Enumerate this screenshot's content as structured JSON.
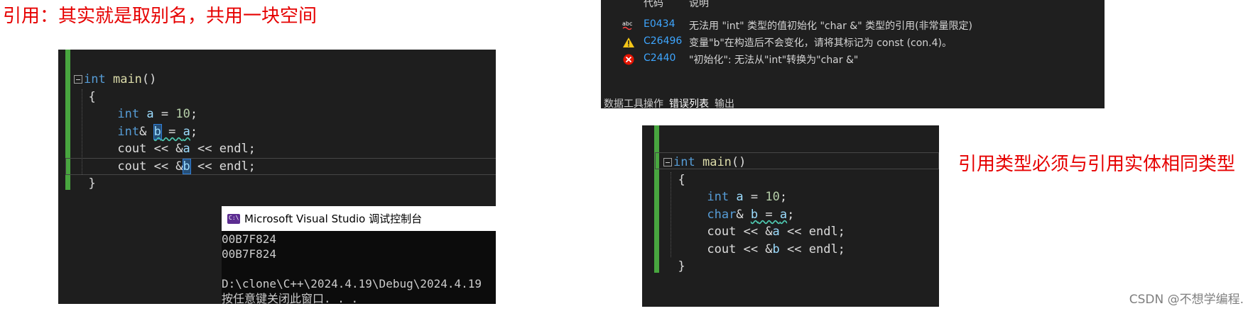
{
  "titles": {
    "left": "引用：其实就是取别名，共用一块空间",
    "right": "引用类型必须与引用实体相同类型"
  },
  "code_left": {
    "line1": {
      "kw": "int",
      "fn": "main",
      "rest": "()"
    },
    "line2": "{",
    "line3": {
      "kw": "int",
      "var": "a",
      "op": " = ",
      "num": "10",
      "end": ";"
    },
    "line4": {
      "kw": "int",
      "amp": "& ",
      "var": "b",
      "op": " = ",
      "var2": "a",
      "end": ";"
    },
    "line5": {
      "pre": "cout << &",
      "var": "a",
      "post": " << endl;"
    },
    "line6": {
      "pre": "cout << &",
      "var": "b",
      "post": " << endl;"
    },
    "line7": "}"
  },
  "console": {
    "title": "Microsoft Visual Studio 调试控制台",
    "lines": [
      "00B7F824",
      "00B7F824",
      "",
      "D:\\clone\\C++\\2024.4.19\\Debug\\2024.4.19",
      "按任意键关闭此窗口. . ."
    ]
  },
  "error_list": {
    "header_code": "代码",
    "header_desc": "说明",
    "rows": [
      {
        "icon": "abc-icon",
        "code": "E0434",
        "desc": "无法用 \"int\" 类型的值初始化 \"char &\" 类型的引用(非常量限定)"
      },
      {
        "icon": "warning-icon",
        "code": "C26496",
        "desc": "变量\"b\"在构造后不会变化，请将其标记为 const (con.4)。"
      },
      {
        "icon": "error-icon",
        "code": "C2440",
        "desc": "\"初始化\": 无法从\"int\"转换为\"char &\""
      }
    ],
    "tabs": [
      "数据工具操作",
      "错误列表",
      "输出"
    ]
  },
  "code_right": {
    "line1": {
      "kw": "int",
      "fn": "main",
      "rest": "()"
    },
    "line2": "{",
    "line3": {
      "kw": "int",
      "var": "a",
      "op": " = ",
      "num": "10",
      "end": ";"
    },
    "line4": {
      "kw": "char",
      "amp": "& ",
      "var": "b",
      "op": " = ",
      "var2": "a",
      "end": ";"
    },
    "line5": {
      "pre": "cout << &",
      "var": "a",
      "post": " << endl;"
    },
    "line6": {
      "pre": "cout << &",
      "var": "b",
      "post": " << endl;"
    },
    "line7": "}"
  },
  "watermark": "CSDN @不想学编程.",
  "colors": {
    "accent_red": "#e60000",
    "gutter_green": "#48a63f",
    "keyword_blue": "#569cd6"
  }
}
